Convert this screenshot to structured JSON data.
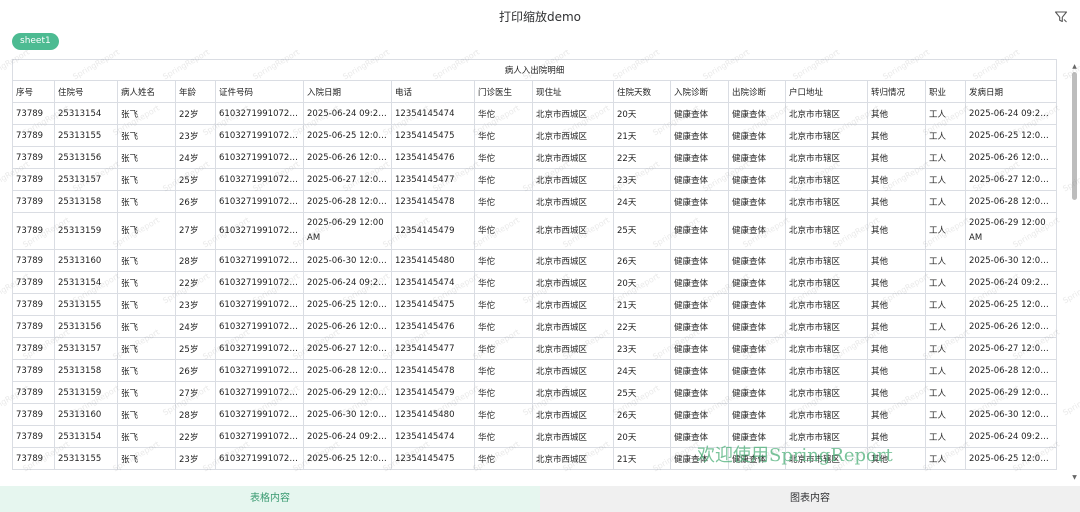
{
  "window": {
    "title": "打印缩放demo",
    "filter_icon": "filter-icon"
  },
  "sheet_tabs": [
    {
      "label": "sheet1",
      "color": "#4dbb92"
    }
  ],
  "table": {
    "title": "病人入出院明细",
    "columns": [
      "序号",
      "住院号",
      "病人姓名",
      "年龄",
      "证件号码",
      "入院日期",
      "电话",
      "门诊医生",
      "现住址",
      "住院天数",
      "入院诊断",
      "出院诊断",
      "户口地址",
      "转归情况",
      "职业",
      "发病日期"
    ],
    "rows": [
      [
        "73789",
        "25313154",
        "张飞",
        "22岁",
        "610327199107222…",
        "2025-06-24 09:25 …",
        "12354145474",
        "华佗",
        "北京市西城区",
        "20天",
        "健康查体",
        "健康查体",
        "北京市市辖区",
        "其他",
        "工人",
        "2025-06-24 09:25 …"
      ],
      [
        "73789",
        "25313155",
        "张飞",
        "23岁",
        "610327199107222…",
        "2025-06-25 12:00 …",
        "12354145475",
        "华佗",
        "北京市西城区",
        "21天",
        "健康查体",
        "健康查体",
        "北京市市辖区",
        "其他",
        "工人",
        "2025-06-25 12:00 …"
      ],
      [
        "73789",
        "25313156",
        "张飞",
        "24岁",
        "610327199107222…",
        "2025-06-26 12:00 …",
        "12354145476",
        "华佗",
        "北京市西城区",
        "22天",
        "健康查体",
        "健康查体",
        "北京市市辖区",
        "其他",
        "工人",
        "2025-06-26 12:00 …"
      ],
      [
        "73789",
        "25313157",
        "张飞",
        "25岁",
        "610327199107222…",
        "2025-06-27 12:00 …",
        "12354145477",
        "华佗",
        "北京市西城区",
        "23天",
        "健康查体",
        "健康查体",
        "北京市市辖区",
        "其他",
        "工人",
        "2025-06-27 12:00 …"
      ],
      [
        "73789",
        "25313158",
        "张飞",
        "26岁",
        "610327199107222…",
        "2025-06-28 12:00 …",
        "12354145478",
        "华佗",
        "北京市西城区",
        "24天",
        "健康查体",
        "健康查体",
        "北京市市辖区",
        "其他",
        "工人",
        "2025-06-28 12:00 …"
      ],
      [
        "73789",
        "25313159",
        "张飞",
        "27岁",
        "610327199107222300",
        "2025-06-29 12:00 AM",
        "12354145479",
        "华佗",
        "北京市西城区",
        "25天",
        "健康查体",
        "健康查体",
        "北京市市辖区",
        "其他",
        "工人",
        "2025-06-29 12:00 AM"
      ],
      [
        "73789",
        "25313160",
        "张飞",
        "28岁",
        "610327199107222…",
        "2025-06-30 12:00 …",
        "12354145480",
        "华佗",
        "北京市西城区",
        "26天",
        "健康查体",
        "健康查体",
        "北京市市辖区",
        "其他",
        "工人",
        "2025-06-30 12:00 …"
      ],
      [
        "73789",
        "25313154",
        "张飞",
        "22岁",
        "610327199107222…",
        "2025-06-24 09:25 …",
        "12354145474",
        "华佗",
        "北京市西城区",
        "20天",
        "健康查体",
        "健康查体",
        "北京市市辖区",
        "其他",
        "工人",
        "2025-06-24 09:25 …"
      ],
      [
        "73789",
        "25313155",
        "张飞",
        "23岁",
        "610327199107222…",
        "2025-06-25 12:00 …",
        "12354145475",
        "华佗",
        "北京市西城区",
        "21天",
        "健康查体",
        "健康查体",
        "北京市市辖区",
        "其他",
        "工人",
        "2025-06-25 12:00 …"
      ],
      [
        "73789",
        "25313156",
        "张飞",
        "24岁",
        "610327199107222…",
        "2025-06-26 12:00 …",
        "12354145476",
        "华佗",
        "北京市西城区",
        "22天",
        "健康查体",
        "健康查体",
        "北京市市辖区",
        "其他",
        "工人",
        "2025-06-26 12:00 …"
      ],
      [
        "73789",
        "25313157",
        "张飞",
        "25岁",
        "610327199107222…",
        "2025-06-27 12:00 …",
        "12354145477",
        "华佗",
        "北京市西城区",
        "23天",
        "健康查体",
        "健康查体",
        "北京市市辖区",
        "其他",
        "工人",
        "2025-06-27 12:00 …"
      ],
      [
        "73789",
        "25313158",
        "张飞",
        "26岁",
        "610327199107222…",
        "2025-06-28 12:00 …",
        "12354145478",
        "华佗",
        "北京市西城区",
        "24天",
        "健康查体",
        "健康查体",
        "北京市市辖区",
        "其他",
        "工人",
        "2025-06-28 12:00 …"
      ],
      [
        "73789",
        "25313159",
        "张飞",
        "27岁",
        "610327199107222…",
        "2025-06-29 12:00 …",
        "12354145479",
        "华佗",
        "北京市西城区",
        "25天",
        "健康查体",
        "健康查体",
        "北京市市辖区",
        "其他",
        "工人",
        "2025-06-29 12:00 …"
      ],
      [
        "73789",
        "25313160",
        "张飞",
        "28岁",
        "610327199107222…",
        "2025-06-30 12:00 …",
        "12354145480",
        "华佗",
        "北京市西城区",
        "26天",
        "健康查体",
        "健康查体",
        "北京市市辖区",
        "其他",
        "工人",
        "2025-06-30 12:00 …"
      ],
      [
        "73789",
        "25313154",
        "张飞",
        "22岁",
        "610327199107222…",
        "2025-06-24 09:25 …",
        "12354145474",
        "华佗",
        "北京市西城区",
        "20天",
        "健康查体",
        "健康查体",
        "北京市市辖区",
        "其他",
        "工人",
        "2025-06-24 09:25 …"
      ],
      [
        "73789",
        "25313155",
        "张飞",
        "23岁",
        "610327199107222…",
        "2025-06-25 12:00 …",
        "12354145475",
        "华佗",
        "北京市西城区",
        "21天",
        "健康查体",
        "健康查体",
        "北京市市辖区",
        "其他",
        "工人",
        "2025-06-25 12:00 …"
      ]
    ],
    "tall_row_index": 5
  },
  "watermark": {
    "text": "欢迎使用SpringReport",
    "faint_text": "SpringReport",
    "color": "#4caf78"
  },
  "bottom_tabs": [
    {
      "label": "表格内容",
      "active": true
    },
    {
      "label": "图表内容",
      "active": false
    }
  ]
}
